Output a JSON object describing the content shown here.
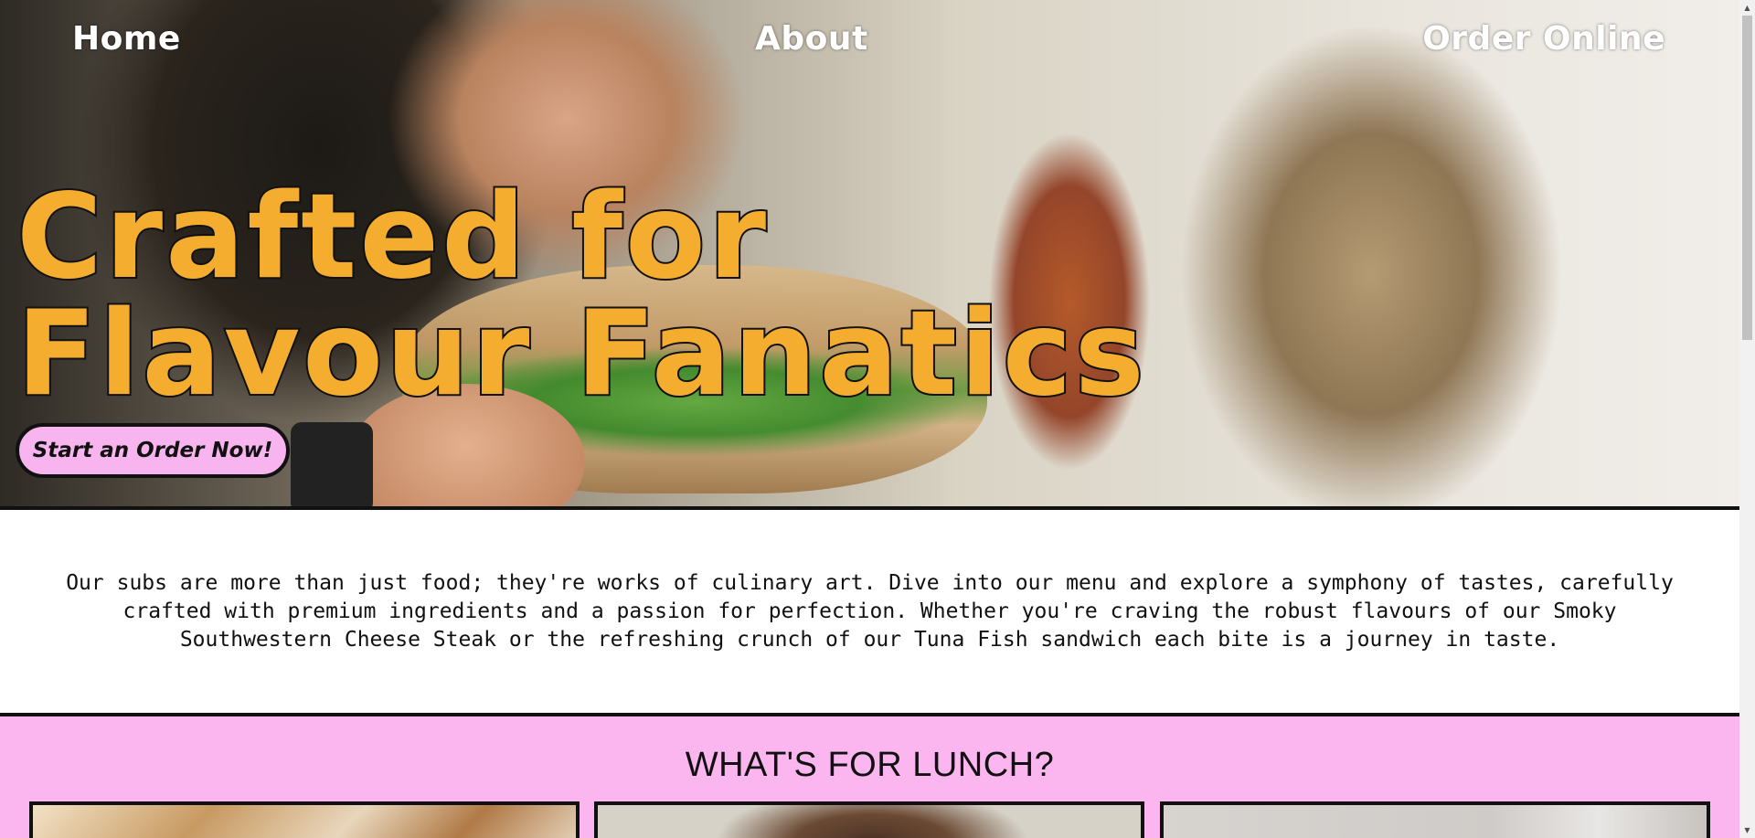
{
  "nav": {
    "home": "Home",
    "about": "About",
    "order_online": "Order Online"
  },
  "hero": {
    "headline_line1": "Crafted for",
    "headline_line2": "Flavour Fanatics",
    "cta_label": "Start an Order Now!"
  },
  "intro": {
    "text": "Our subs are more than just food; they're works of culinary art. Dive into our menu and explore a symphony of tastes, carefully crafted with premium ingredients and a passion for perfection. Whether you're craving the robust flavours of our Smoky Southwestern Cheese Steak or the refreshing crunch of our Tuna Fish sandwich each bite is a journey in taste."
  },
  "lunch": {
    "heading": "WHAT'S FOR LUNCH?"
  },
  "colors": {
    "headline": "#f5ad2f",
    "cta_bg": "#f8b4ee",
    "lunch_bg": "#fbb6ef",
    "border": "#111111"
  },
  "icons": {
    "scroll_up": "triangle-up-icon",
    "scroll_down": "triangle-down-icon"
  }
}
